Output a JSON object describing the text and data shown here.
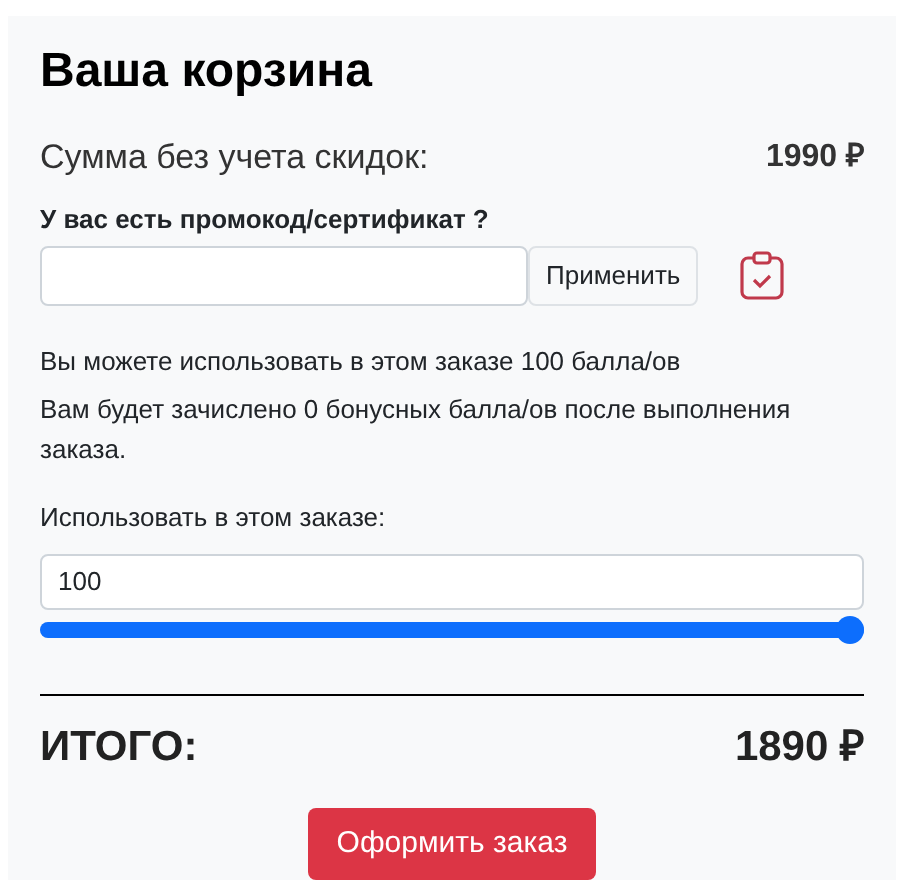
{
  "title": "Ваша корзина",
  "subtotal": {
    "label": "Сумма без учета скидок:",
    "value": "1990 ₽"
  },
  "promo": {
    "label": "У вас есть промокод/сертификат ?",
    "button": "Применить"
  },
  "bonus_info": [
    "Вы можете использовать в этом заказе 100 балла/ов",
    "Вам будет зачислено 0 бонусных балла/ов после выполнения заказа."
  ],
  "use_points": {
    "label": "Использовать в этом заказе:",
    "value": "100",
    "level": 1
  },
  "total": {
    "label": "ИТОГО:",
    "value": "1890 ₽"
  },
  "checkout_button": "Оформить заказ"
}
